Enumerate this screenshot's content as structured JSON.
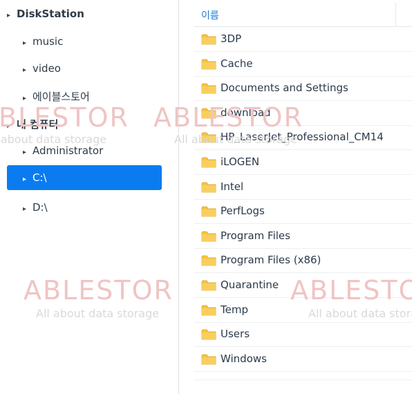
{
  "tree": {
    "items": [
      {
        "label": "DiskStation",
        "arrow": "▸"
      },
      {
        "label": "music",
        "arrow": "▸"
      },
      {
        "label": "video",
        "arrow": "▸"
      },
      {
        "label": "에이블스토어",
        "arrow": "▸"
      },
      {
        "label": "내 컴퓨터",
        "arrow": "▸"
      },
      {
        "label": "Administrator",
        "arrow": "▸"
      },
      {
        "label": "C:\\",
        "arrow": "▸"
      },
      {
        "label": "D:\\",
        "arrow": "▸"
      }
    ]
  },
  "list": {
    "header": "이름",
    "folders": [
      "3DP",
      "Cache",
      "Documents and Settings",
      "download",
      "HP_LaserJet_Professional_CM14",
      "iLOGEN",
      "Intel",
      "PerfLogs",
      "Program Files",
      "Program Files (x86)",
      "Quarantine",
      "Temp",
      "Users",
      "Windows"
    ]
  },
  "watermark": {
    "brand": "ABLESTOR",
    "tagline": "All about data storage"
  },
  "colors": {
    "selection": "#0b7cf0",
    "header_text": "#1a7ad6",
    "folder": "#f6c344"
  }
}
